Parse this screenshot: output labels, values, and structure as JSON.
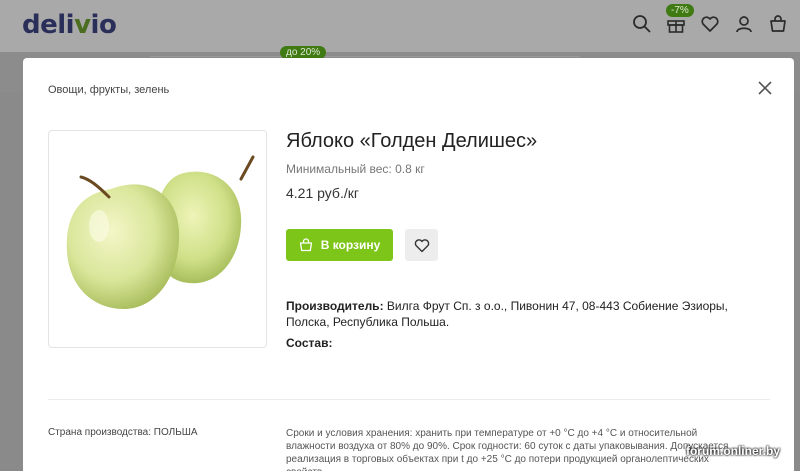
{
  "header": {
    "logo": {
      "pre": "deli",
      "v": "v",
      "post": "io"
    },
    "gift_badge": "-7%",
    "promo_badge": "до 20%",
    "icons": [
      "search-icon",
      "gift-icon",
      "heart-icon",
      "user-icon",
      "cart-icon"
    ]
  },
  "modal": {
    "breadcrumb": "Овощи, фрукты, зелень",
    "product": {
      "title": "Яблоко «Голден Делишес»",
      "min_weight": "Минимальный вес: 0.8 кг",
      "price": "4.21 руб./кг",
      "cart_label": "В корзину",
      "producer_label": "Производитель:",
      "producer_value": "Вилга Фрут Сп. з о.о., Пивонин 47, 08-443 Собиение Эзиоры, Полска, Республика Польша.",
      "composition_label": "Состав:"
    },
    "country": "Страна производства: ПОЛЬША",
    "storage": "Сроки и условия хранения: хранить при температуре от +0 °С до +4 °С и относительной влажности воздуха от 80% до 90%. Срок годности: 60 суток с даты упаковывания. Допускается реализация в торговых объектах при t до +25 °С до потери продукцией органолептических свойств."
  },
  "watermark": "forum.onliner.by",
  "colors": {
    "accent_green": "#7ec51a",
    "badge_green": "#3f7a13",
    "logo_navy": "#2a2f5a"
  }
}
